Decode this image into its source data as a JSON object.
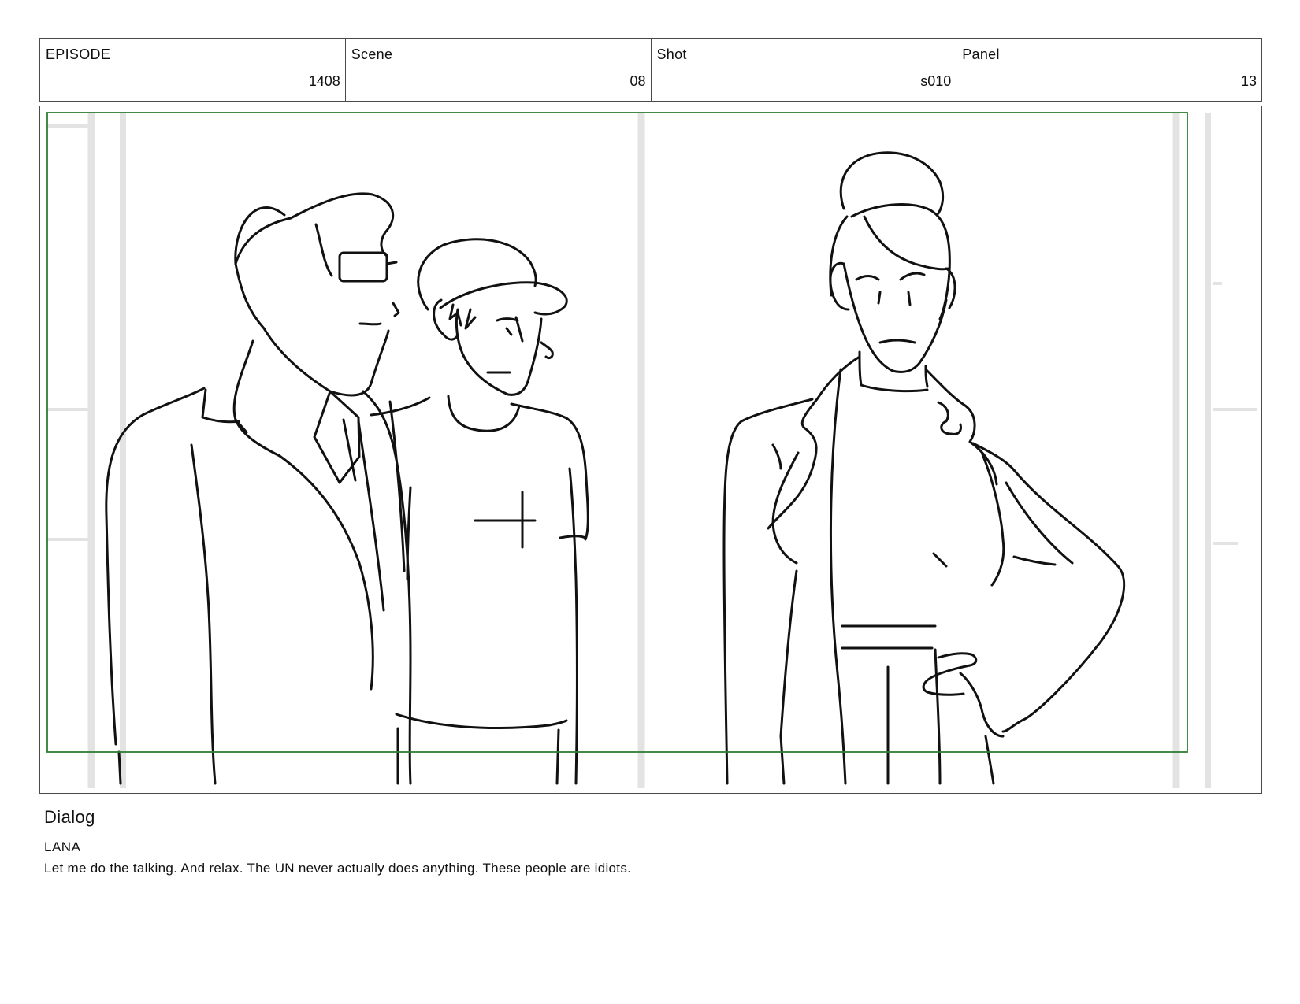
{
  "header": {
    "episode": {
      "label": "EPISODE",
      "value": "1408"
    },
    "scene": {
      "label": "Scene",
      "value": "08"
    },
    "shot": {
      "label": "Shot",
      "value": "s010"
    },
    "panel": {
      "label": "Panel",
      "value": "13"
    }
  },
  "dialog": {
    "heading": "Dialog",
    "speaker": "LANA",
    "line": "Let me do the talking. And relax. The UN never actually does anything. These people are idiots."
  },
  "colors": {
    "safe_area": "#2e7d32",
    "border": "#4a4a4a",
    "ink": "#111111",
    "background_lines": "#e3e3e3"
  }
}
